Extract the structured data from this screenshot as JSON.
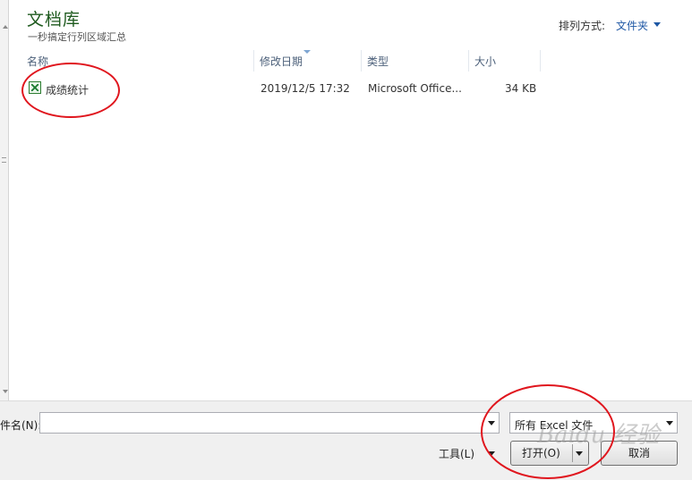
{
  "library": {
    "title": "文档库",
    "subtitle": "一秒搞定行列区域汇总",
    "arrange_label": "排列方式:",
    "arrange_value": "文件夹"
  },
  "columns": [
    "名称",
    "修改日期",
    "类型",
    "大小"
  ],
  "files": [
    {
      "name": "成绩统计",
      "date": "2019/12/5 17:32",
      "type": "Microsoft Office...",
      "size": "34 KB",
      "icon": "excel-file-icon"
    }
  ],
  "footer": {
    "filename_label": "件名(N):",
    "filename_value": "",
    "filter_value": "所有 Excel 文件",
    "tools_label": "工具(L)",
    "open_label": "打开(O)",
    "cancel_label": "取消"
  },
  "watermark": "Baidu 经验",
  "colors": {
    "annotation": "#e0161e",
    "title_green": "#1e5a1e",
    "link_blue": "#1e57a4"
  }
}
